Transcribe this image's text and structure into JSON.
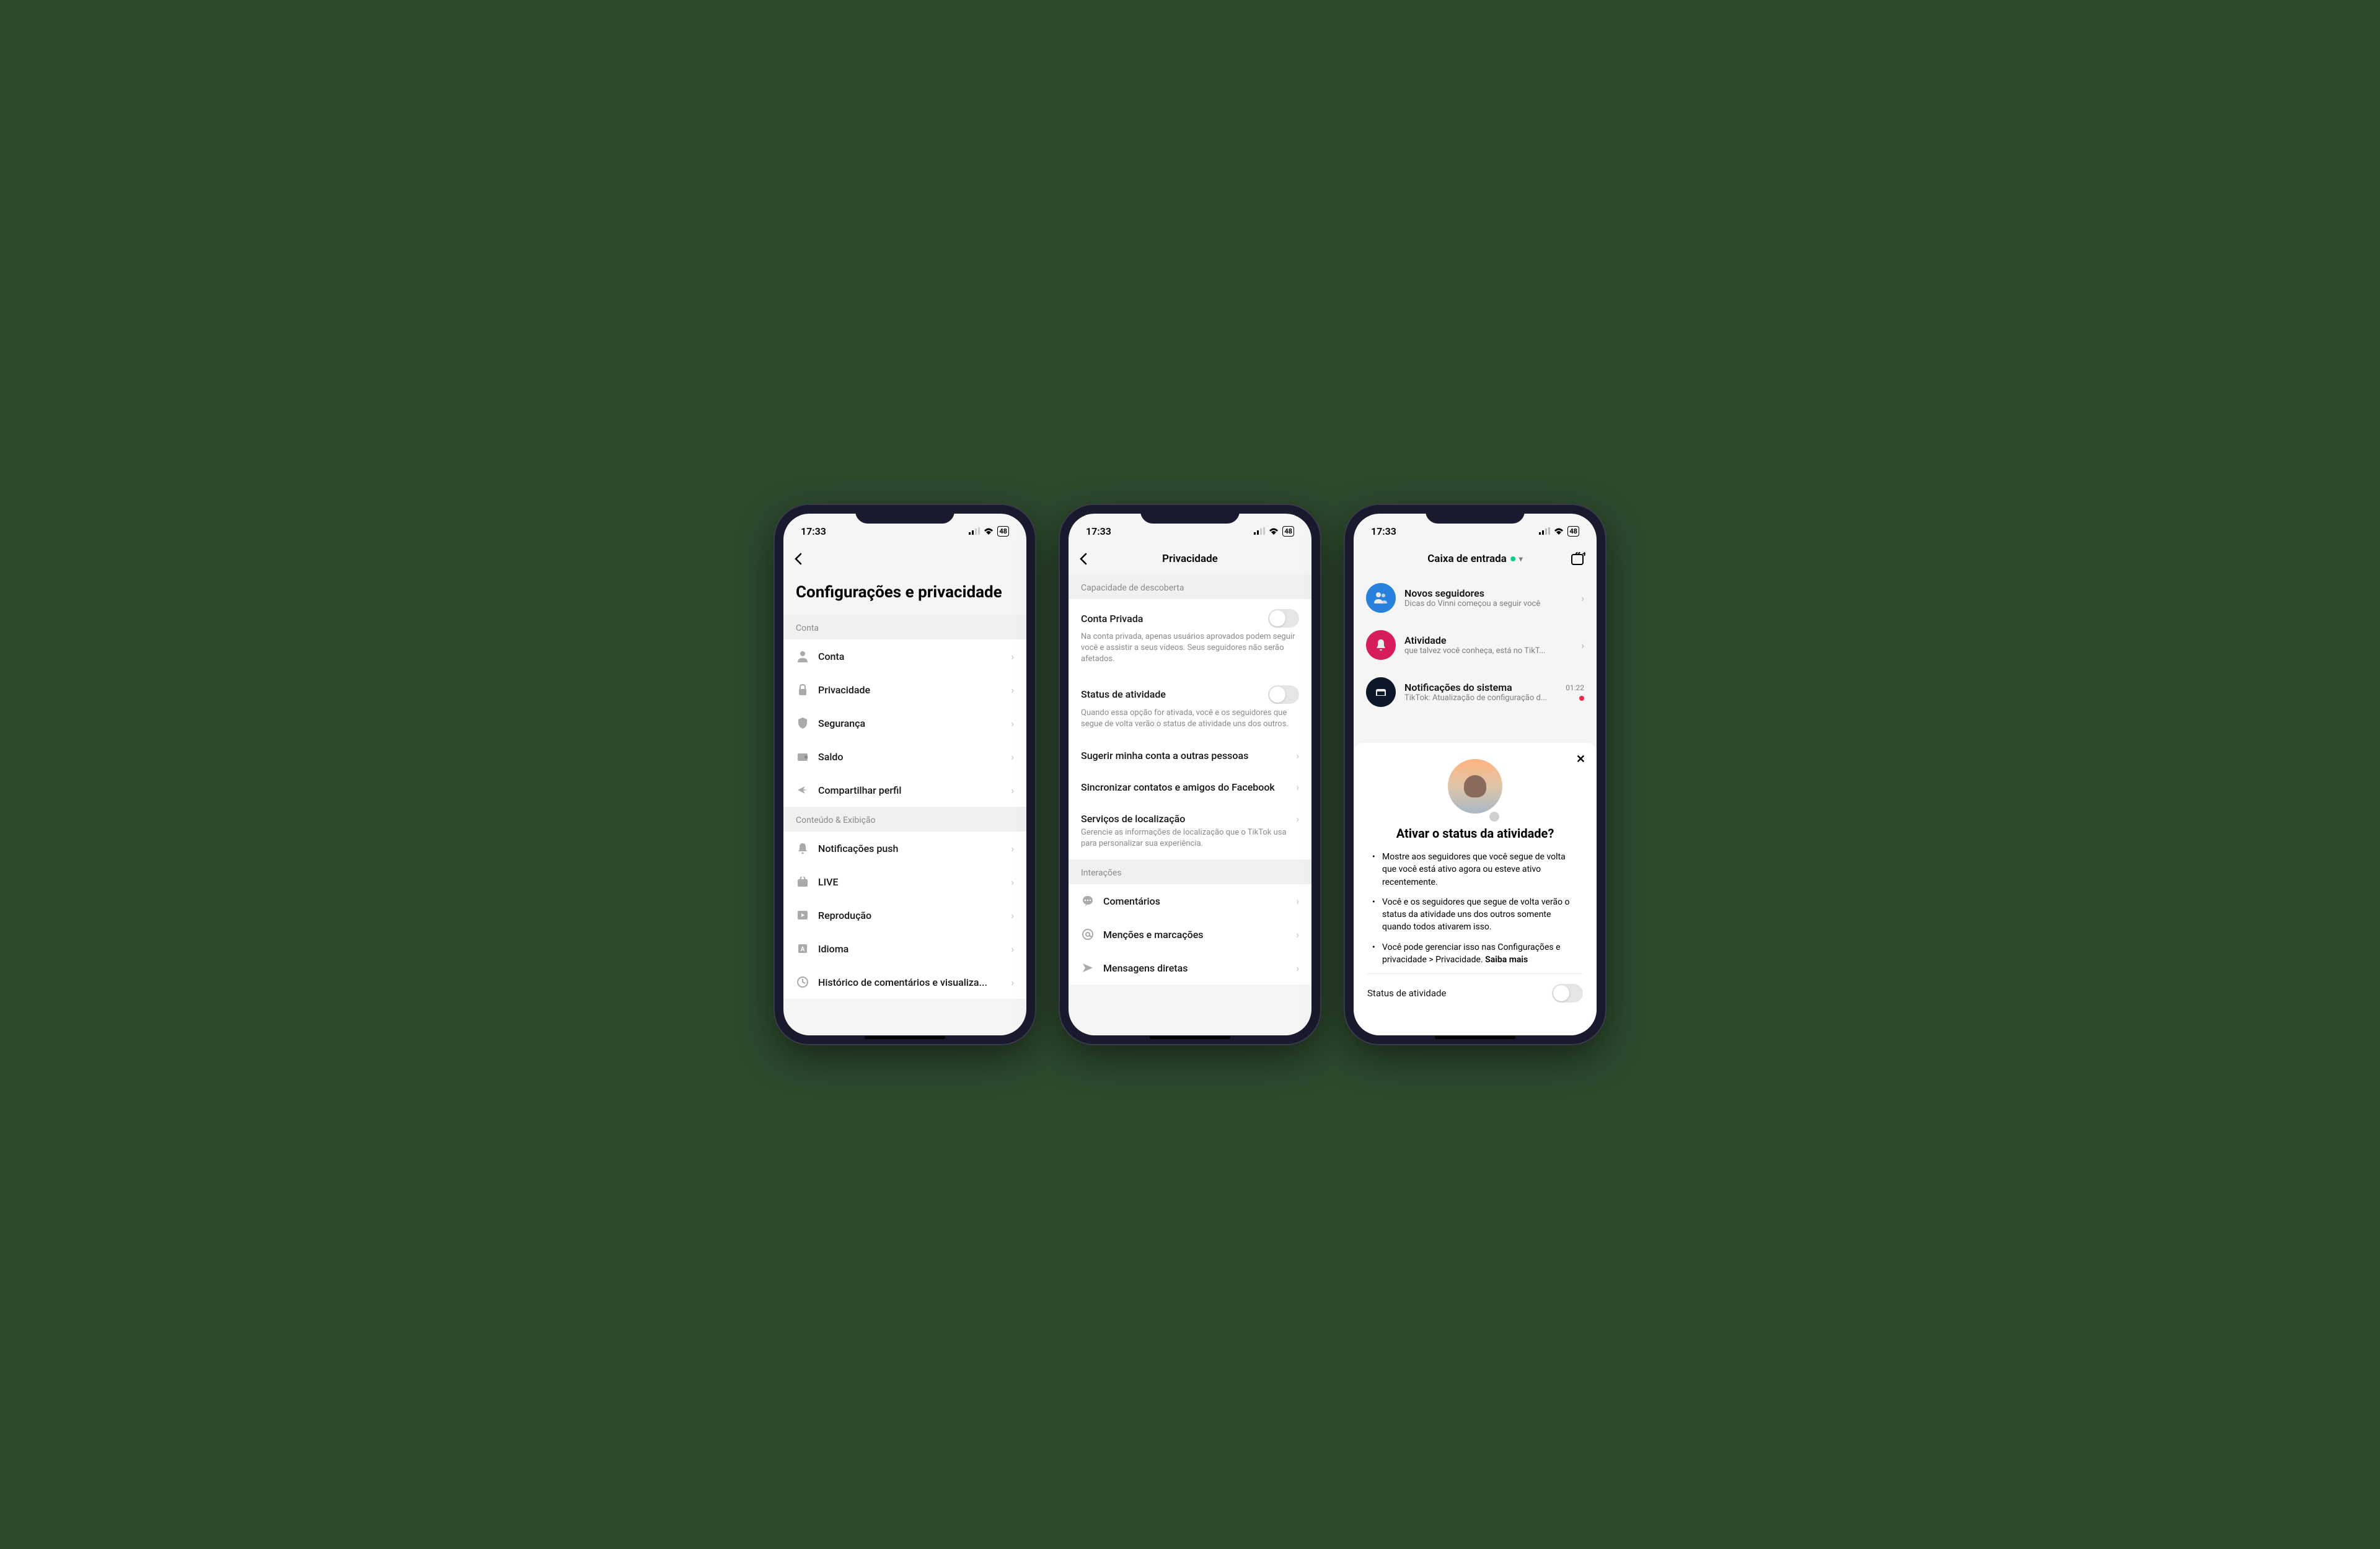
{
  "status": {
    "time": "17:33",
    "battery": "48"
  },
  "screen1": {
    "page_title": "Configurações e privacidade",
    "sections": [
      {
        "header": "Conta",
        "items": [
          {
            "icon": "user-icon",
            "label": "Conta"
          },
          {
            "icon": "lock-icon",
            "label": "Privacidade"
          },
          {
            "icon": "shield-icon",
            "label": "Segurança"
          },
          {
            "icon": "wallet-icon",
            "label": "Saldo"
          },
          {
            "icon": "share-icon",
            "label": "Compartilhar perfil"
          }
        ]
      },
      {
        "header": "Conteúdo & Exibição",
        "items": [
          {
            "icon": "bell-icon",
            "label": "Notificações push"
          },
          {
            "icon": "live-icon",
            "label": "LIVE"
          },
          {
            "icon": "play-icon",
            "label": "Reprodução"
          },
          {
            "icon": "language-icon",
            "label": "Idioma"
          },
          {
            "icon": "history-icon",
            "label": "Histórico de comentários e visualiza..."
          }
        ]
      }
    ]
  },
  "screen2": {
    "nav_title": "Privacidade",
    "section1_header": "Capacidade de descoberta",
    "private_account": {
      "label": "Conta Privada",
      "desc": "Na conta privada, apenas usuários aprovados podem seguir você e assistir a seus vídeos. Seus seguidores não serão afetados."
    },
    "activity_status": {
      "label": "Status de atividade",
      "desc": "Quando essa opção for ativada, você e os seguidores que segue de volta verão o status de atividade uns dos outros."
    },
    "suggest": {
      "label": "Sugerir minha conta a outras pessoas"
    },
    "sync": {
      "label": "Sincronizar contatos e amigos do Facebook"
    },
    "location": {
      "label": "Serviços de localização",
      "desc": "Gerencie as informações de localização que o TikTok usa para personalizar sua experiência."
    },
    "section2_header": "Interações",
    "comments": {
      "label": "Comentários"
    },
    "mentions": {
      "label": "Menções e marcações"
    },
    "dms": {
      "label": "Mensagens diretas"
    }
  },
  "screen3": {
    "nav_title": "Caixa de entrada",
    "items": [
      {
        "title": "Novos seguidores",
        "sub": "Dicas do Vinni começou a seguir você",
        "color": "blue"
      },
      {
        "title": "Atividade",
        "sub": "que talvez você conheça, está no TikT...",
        "color": "pink"
      },
      {
        "title": "Notificações do sistema",
        "sub": "TikTok: Atualização de configuração d...",
        "time": "01:22",
        "color": "dark"
      }
    ],
    "modal": {
      "title": "Ativar o status da atividade?",
      "bullets": [
        "Mostre aos seguidores que você segue de volta que você está ativo agora ou esteve ativo recentemente.",
        "Você e os seguidores que segue de volta verão o status da atividade uns dos outros somente quando todos ativarem isso.",
        "Você pode gerenciar isso nas Configurações e privacidade > Privacidade."
      ],
      "learn_more": "Saiba mais",
      "toggle_label": "Status de atividade"
    }
  }
}
